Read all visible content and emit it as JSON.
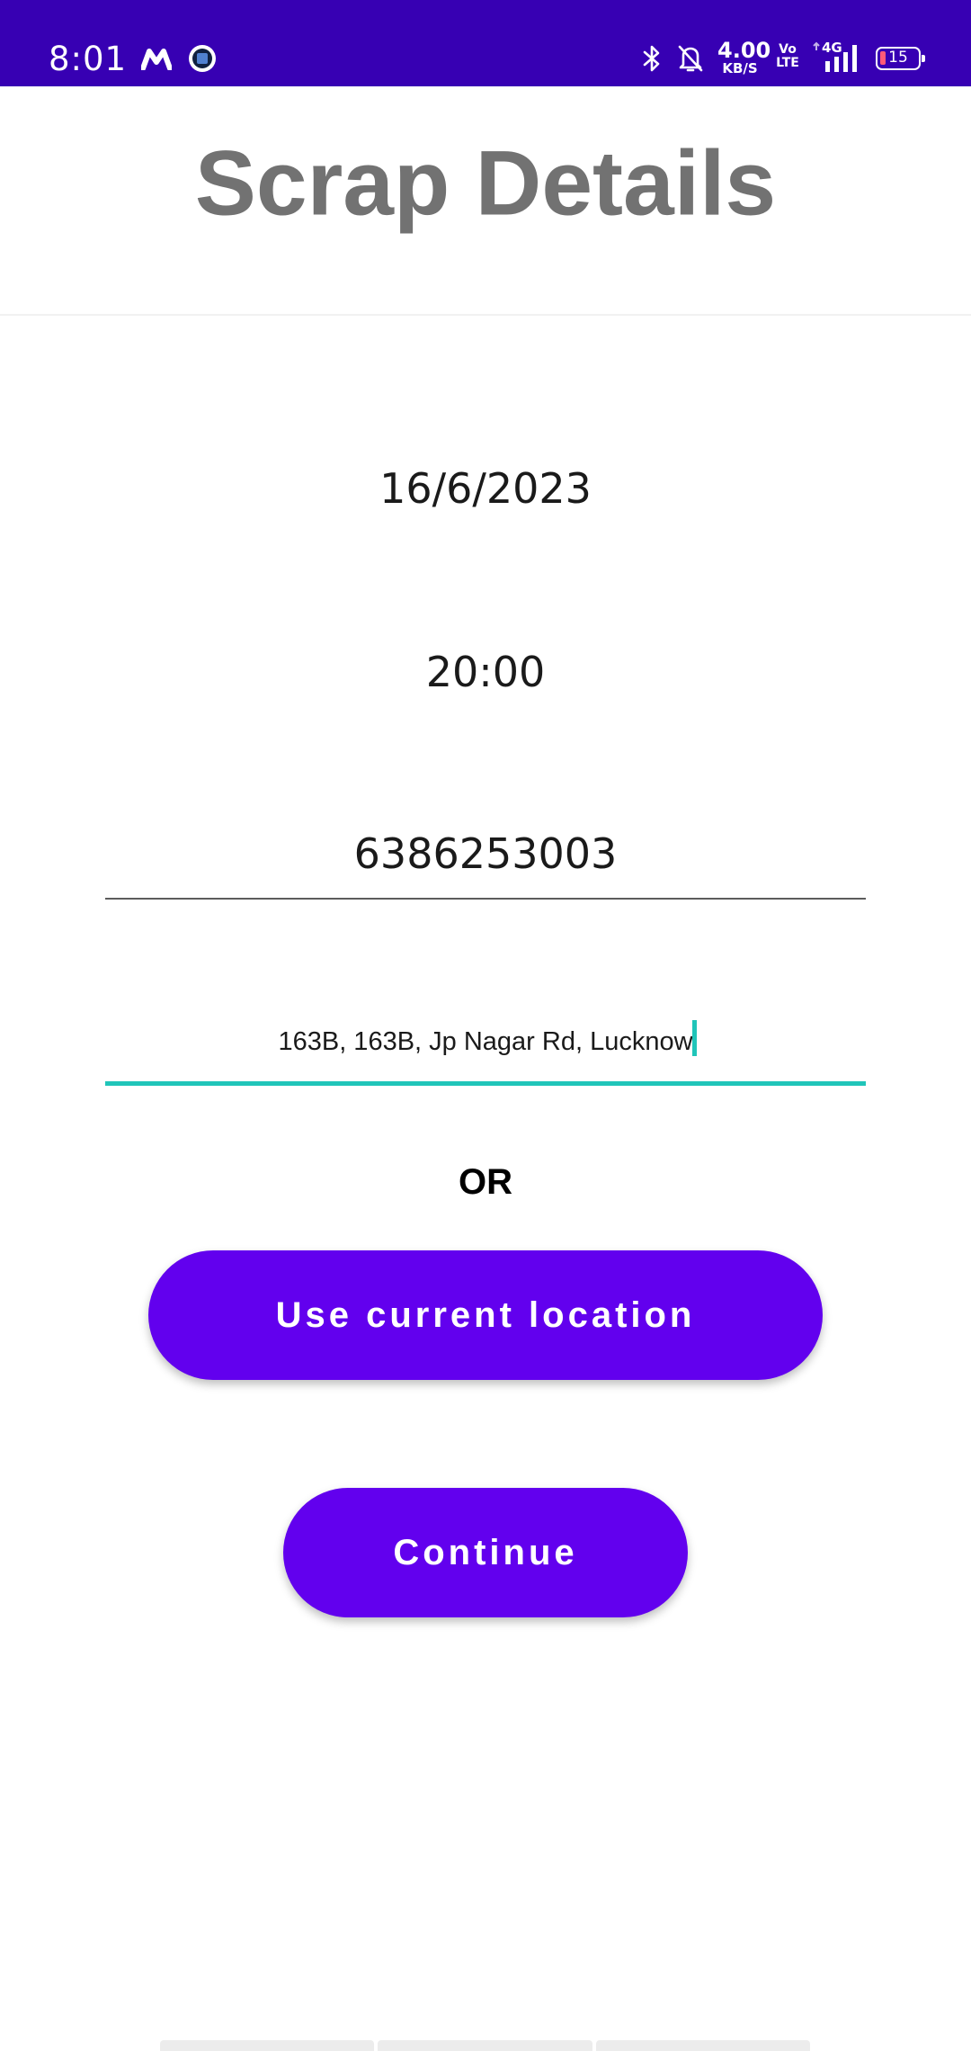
{
  "status_bar": {
    "time": "8:01",
    "net_speed_value": "4.00",
    "net_speed_unit": "KB/S",
    "volte_line1": "Vo",
    "volte_line2": "LTE",
    "network_type": "4G",
    "battery_level": "15",
    "icons": [
      "myntra-m-icon",
      "app-notification-icon",
      "bluetooth-icon",
      "bell-off-icon",
      "signal-icon",
      "battery-icon"
    ],
    "background_color": "#3700b3"
  },
  "header": {
    "title": "Scrap Details"
  },
  "form": {
    "date": "16/6/2023",
    "time": "20:00",
    "phone": "6386253003",
    "address": "163B, 163B, Jp Nagar Rd, Lucknow",
    "focused_field": "address",
    "focus_color": "#20c5b9"
  },
  "or_label": "OR",
  "buttons": {
    "use_location_label": "Use current location",
    "continue_label": "Continue",
    "color": "#6200ee"
  }
}
